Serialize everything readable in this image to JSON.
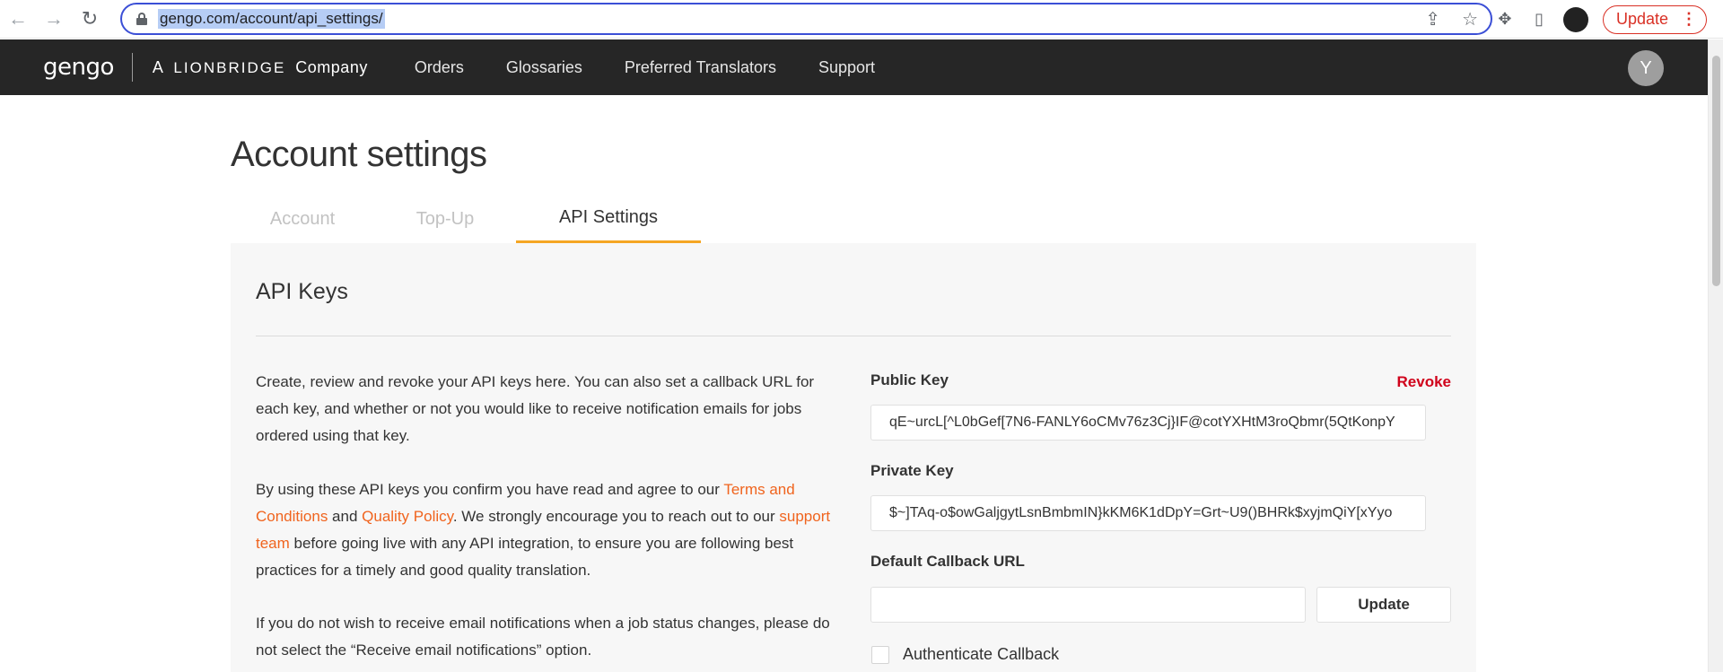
{
  "browser": {
    "url": "gengo.com/account/api_settings/",
    "update_label": "Update",
    "update_menu": "⋮"
  },
  "header": {
    "logo": "gengo",
    "tagline_prefix": "A",
    "tagline_brand": "LIONBRIDGE",
    "tagline_suffix": "Company",
    "nav": [
      "Orders",
      "Glossaries",
      "Preferred Translators",
      "Support"
    ],
    "avatar_initial": "Y"
  },
  "page": {
    "title": "Account settings",
    "tabs": [
      "Account",
      "Top-Up",
      "API Settings"
    ],
    "active_tab": "API Settings"
  },
  "api_keys": {
    "title": "API Keys",
    "desc1": "Create, review and revoke your API keys here. You can also set a callback URL for each key, and whether or not you would like to receive notification emails for jobs ordered using that key.",
    "desc2_part1": "By using these API keys you confirm you have read and agree to our ",
    "desc2_link1": "Terms and Conditions",
    "desc2_part2": " and ",
    "desc2_link2": "Quality Policy",
    "desc2_part3": ". We strongly encourage you to reach out to our ",
    "desc2_link3": "support team",
    "desc2_part4": " before going live with any API integration, to ensure you are following best practices for a timely and good quality translation.",
    "desc3": "If you do not wish to receive email notifications when a job status changes, please do not select the “Receive email notifications” option.",
    "public_key_label": "Public Key",
    "revoke_label": "Revoke",
    "public_key_value": "qE~urcL[^L0bGef[7N6-FANLY6oCMv76z3Cj}IF@cotYXHtM3roQbmr(5QtKonpY",
    "private_key_label": "Private Key",
    "private_key_value": "$~]TAq-o$owGaljgytLsnBmbmIN}kKM6K1dDpY=Grt~U9()BHRk$xyjmQiY[xYyo",
    "callback_label": "Default Callback URL",
    "callback_value": "",
    "update_button": "Update",
    "auth_callback_label": "Authenticate Callback"
  },
  "colors": {
    "header_bg": "#262626",
    "tab_accent": "#f5a623",
    "link": "#f0641e",
    "revoke": "#d0021b",
    "omnibox_focus": "#3b4fd6"
  }
}
